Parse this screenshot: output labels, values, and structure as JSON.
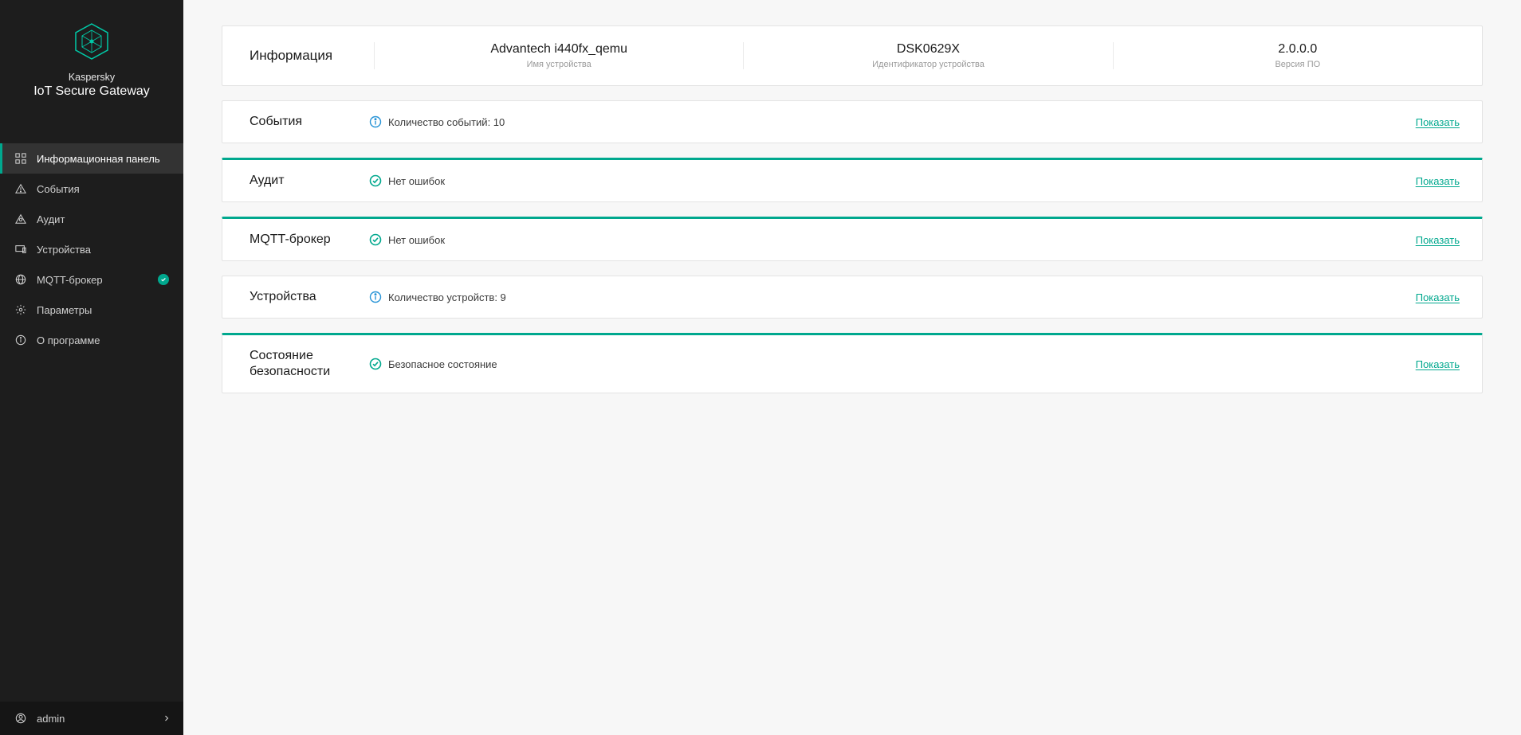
{
  "brand": {
    "line1": "Kaspersky",
    "line2": "IoT Secure Gateway"
  },
  "sidebar": {
    "items": [
      {
        "label": "Информационная панель"
      },
      {
        "label": "События"
      },
      {
        "label": "Аудит"
      },
      {
        "label": "Устройства"
      },
      {
        "label": "MQTT-брокер"
      },
      {
        "label": "Параметры"
      },
      {
        "label": "О программе"
      }
    ]
  },
  "footer": {
    "username": "admin"
  },
  "info": {
    "heading": "Информация",
    "device_name": {
      "value": "Advantech i440fx_qemu",
      "label": "Имя устройства"
    },
    "device_id": {
      "value": "DSK0629X",
      "label": "Идентификатор устройства"
    },
    "version": {
      "value": "2.0.0.0",
      "label": "Версия ПО"
    }
  },
  "rows": {
    "events": {
      "title": "События",
      "text": "Количество событий: 10",
      "link": "Показать",
      "icon": "info",
      "accent": false
    },
    "audit": {
      "title": "Аудит",
      "text": "Нет ошибок",
      "link": "Показать",
      "icon": "ok",
      "accent": true
    },
    "mqtt": {
      "title": "MQTT-брокер",
      "text": "Нет ошибок",
      "link": "Показать",
      "icon": "ok",
      "accent": true
    },
    "devices": {
      "title": "Устройства",
      "text": "Количество устройств: 9",
      "link": "Показать",
      "icon": "info",
      "accent": false
    },
    "security": {
      "title": "Состояние безопасности",
      "text": "Безопасное состояние",
      "link": "Показать",
      "icon": "ok",
      "accent": true
    }
  },
  "colors": {
    "accent": "#00a88e",
    "info_blue": "#2693d6"
  }
}
